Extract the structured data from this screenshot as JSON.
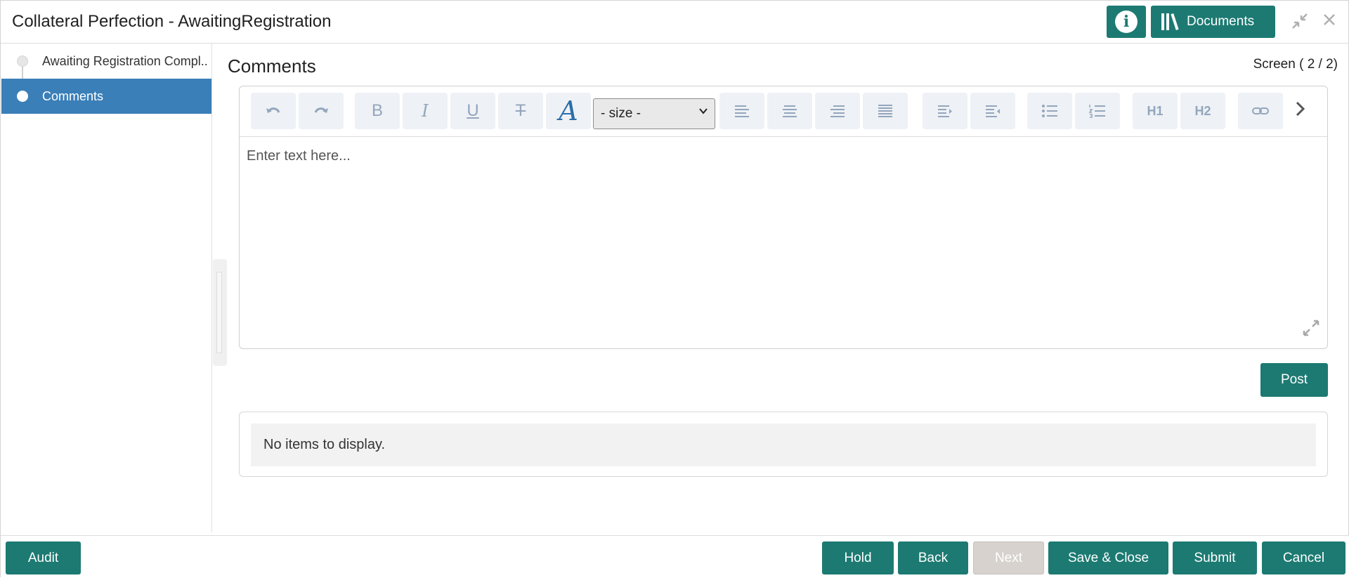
{
  "header": {
    "title": "Collateral Perfection - AwaitingRegistration",
    "info_icon": "i",
    "documents_label": "Documents"
  },
  "sidebar": {
    "items": [
      {
        "label": "Awaiting Registration Compl...",
        "active": false
      },
      {
        "label": "Comments",
        "active": true
      }
    ]
  },
  "main": {
    "title": "Comments",
    "screen_counter": "Screen ( 2 / 2)",
    "editor": {
      "size_select_value": "- size -",
      "placeholder": "Enter text here...",
      "toolbar_icons": [
        "undo-icon",
        "redo-icon",
        "bold-icon",
        "italic-icon",
        "underline-icon",
        "strikethrough-icon",
        "font-color-icon",
        "align-left-icon",
        "align-center-icon",
        "align-right-icon",
        "align-justify-icon",
        "indent-icon",
        "outdent-icon",
        "bulleted-list-icon",
        "numbered-list-icon",
        "heading1-icon",
        "heading2-icon",
        "link-icon",
        "more-chevron-icon"
      ],
      "labels": {
        "bold": "B",
        "italic": "I",
        "underline": "U",
        "strike": "T",
        "font": "A",
        "h1": "H1",
        "h2": "H2"
      }
    },
    "post_label": "Post",
    "empty_message": "No items to display."
  },
  "footer": {
    "audit": "Audit",
    "hold": "Hold",
    "back": "Back",
    "next": "Next",
    "save_close": "Save & Close",
    "submit": "Submit",
    "cancel": "Cancel"
  },
  "colors": {
    "accent": "#1c7a72",
    "sidebar_active": "#3a7fb8",
    "disabled": "#d7d2cd"
  }
}
